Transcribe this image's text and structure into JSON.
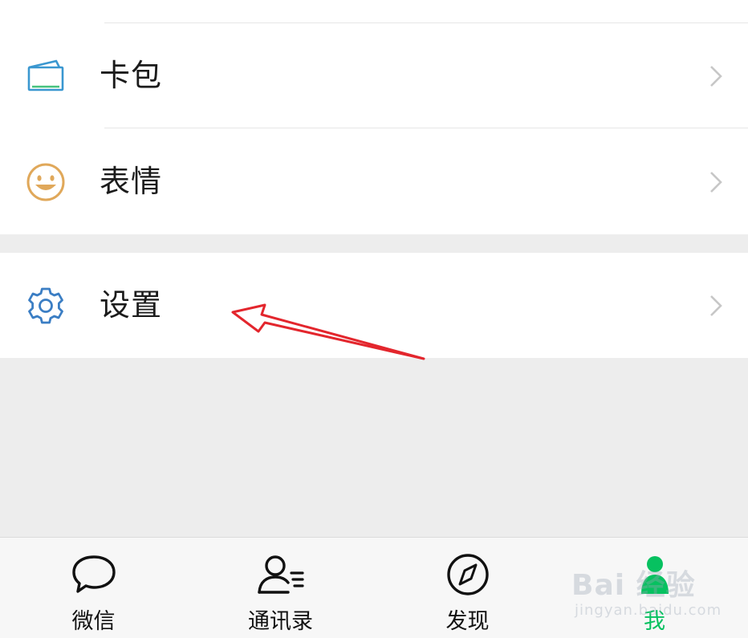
{
  "menu": {
    "items": [
      {
        "label": "卡包",
        "icon": "card-wallet-icon"
      },
      {
        "label": "表情",
        "icon": "smiley-icon"
      },
      {
        "label": "设置",
        "icon": "gear-icon"
      }
    ]
  },
  "tabbar": {
    "tabs": [
      {
        "label": "微信",
        "icon": "chat-bubble-icon",
        "active": false
      },
      {
        "label": "通讯录",
        "icon": "contacts-icon",
        "active": false
      },
      {
        "label": "发现",
        "icon": "compass-icon",
        "active": false
      },
      {
        "label": "我",
        "icon": "person-icon",
        "active": true
      }
    ]
  },
  "watermark": {
    "main": "Bai 经验",
    "sub": "jingyan.baidu.com"
  },
  "colors": {
    "accent": "#07c160",
    "card_icon": "#3a97d0",
    "smiley_icon": "#e0a85a",
    "gear_icon": "#3b7ec4",
    "annotation_arrow": "#e3262d",
    "background": "#ededed"
  }
}
